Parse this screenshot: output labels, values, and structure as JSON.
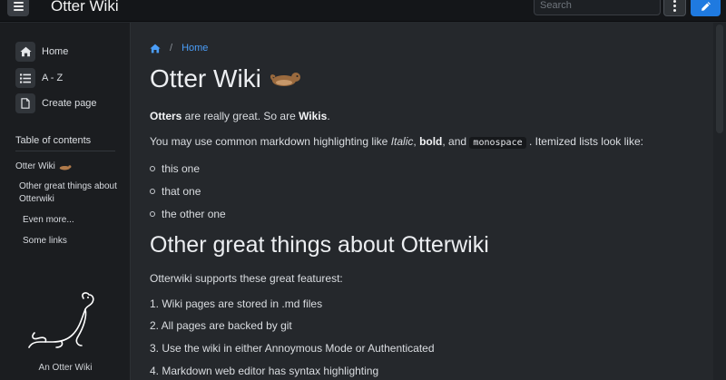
{
  "header": {
    "brand": "Otter Wiki",
    "search_placeholder": "Search"
  },
  "sidebar": {
    "nav": [
      {
        "label": "Home",
        "icon": "home-icon"
      },
      {
        "label": "A - Z",
        "icon": "list-icon"
      },
      {
        "label": "Create page",
        "icon": "file-icon"
      }
    ],
    "toc_title": "Table of contents",
    "toc": [
      {
        "label": "Otter Wiki"
      },
      {
        "label": "Other great things about Otterwiki"
      },
      {
        "label": "Even more..."
      },
      {
        "label": "Some links"
      }
    ],
    "footer": "An Otter Wiki"
  },
  "breadcrumb": {
    "separator": "/",
    "current": "Home"
  },
  "content": {
    "title": "Otter Wiki",
    "intro": {
      "b1": "Otters",
      "t1": " are really great. So are ",
      "b2": "Wikis",
      "t2": "."
    },
    "markdown_line": {
      "t1": "You may use common markdown highlighting like ",
      "italic": "Italic",
      "t2": ", ",
      "bold": "bold",
      "t3": ", and ",
      "mono": "monospace",
      "t4": " . Itemized lists look like:"
    },
    "bullets": [
      "this one",
      "that one",
      "the other one"
    ],
    "section_title": "Other great things about Otterwiki",
    "supports": "Otterwiki supports these great featurest:",
    "features": [
      "1. Wiki pages are stored in .md files",
      "2. All pages are backed by git",
      "3. Use the wiki in either Annoymous Mode or Authenticated",
      "4. Markdown web editor has syntax highlighting"
    ]
  },
  "colors": {
    "accent": "#1f7ae0",
    "link": "#4a9df8",
    "background": "#25282c",
    "sidebar": "#1b1d20",
    "topbar": "#141619"
  }
}
